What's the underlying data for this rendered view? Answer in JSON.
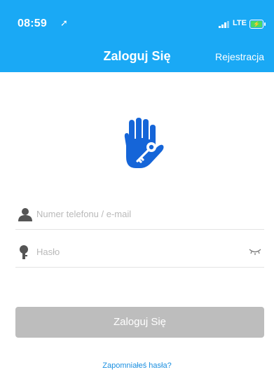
{
  "status_bar": {
    "time": "08:59",
    "network": "LTE"
  },
  "header": {
    "title": "Zaloguj Się",
    "register_label": "Rejestracja"
  },
  "form": {
    "username_placeholder": "Numer telefonu / e-mail",
    "password_placeholder": "Hasło"
  },
  "login_button_label": "Zaloguj Się",
  "forgot_password_label": "Zapomniałeś hasła?",
  "icons": {
    "logo": "hand-key-icon",
    "username": "person-icon",
    "password": "key-icon",
    "password_toggle": "eye-closed-icon"
  },
  "colors": {
    "accent": "#1aa9f5",
    "logo_blue": "#1565d8",
    "button_disabled": "#bdbdbd",
    "link": "#1a8fe0"
  }
}
